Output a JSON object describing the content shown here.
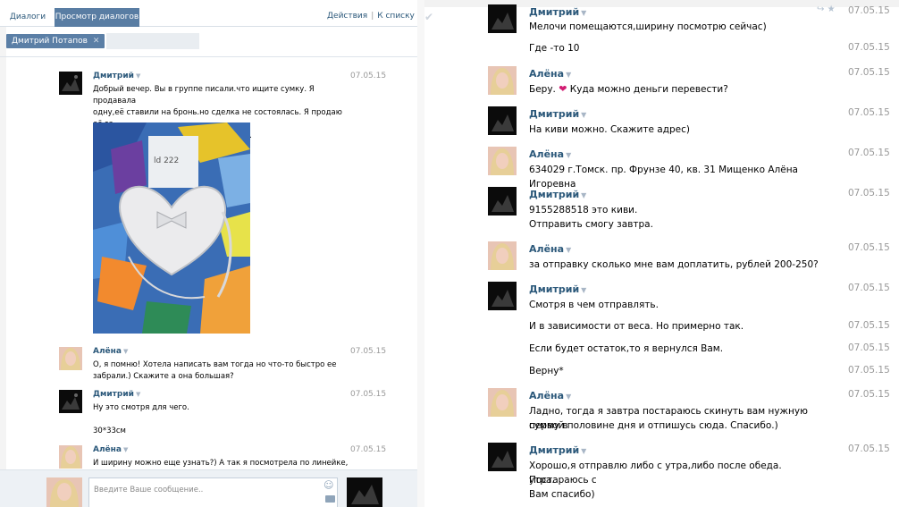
{
  "left": {
    "tabs": [
      "Диалоги",
      "Просмотр диалогов"
    ],
    "top_links": [
      "Действия",
      "К списку дру"
    ],
    "chip": {
      "label": "Дмитрий Потапов",
      "close": "✕"
    },
    "messages": [
      {
        "author": "Дмитрий",
        "date": "07.05.15",
        "lines": [
          "Добрый вечер. Вы в группе писали.что ищите сумку. Я продавала",
          "одну,её ставили на бронь.но сделка не состоялась. Я продаю её за",
          "600 руб,если заинтересует, то пишите."
        ]
      },
      {
        "author": "Алёна",
        "date": "07.05.15",
        "lines": [
          "О, я помню! Хотела написать вам тогда но что-то быстро ее",
          "забрали.) Скажите а она большая?"
        ]
      },
      {
        "author": "Дмитрий",
        "date": "07.05.15",
        "lines": [
          "Ну это смотря для чего.",
          "",
          "30*33см"
        ]
      },
      {
        "author": "Алёна",
        "date": "07.05.15",
        "lines": [
          "И ширину можно еще узнать?) А так я посмотрела по линейке,"
        ]
      }
    ],
    "photo_note": "ld 222",
    "composer": {
      "placeholder": "Введите Ваше сообщение.."
    }
  },
  "right": {
    "messages": [
      {
        "author": "Дмитрий",
        "lines": [
          {
            "text": "Мелочи помещаются,ширину посмотрю сейчас)",
            "date": "07.05.15"
          },
          {
            "text": "Где -то 10",
            "date": "07.05.15"
          }
        ]
      },
      {
        "author": "Алёна",
        "lines": [
          {
            "text": "Беру.",
            "extra": "Куда можно деньги перевести?",
            "date": "07.05.15"
          }
        ]
      },
      {
        "author": "Дмитрий",
        "lines": [
          {
            "text": "На киви можно. Скажите адрес)",
            "date": "07.05.15"
          }
        ]
      },
      {
        "author": "Алёна",
        "lines": [
          {
            "text": "634029 г.Томск. пр. Фрунзе 40, кв. 31 Мищенко Алёна Игоревна",
            "date": "07.05.15"
          }
        ]
      },
      {
        "author": "Дмитрий",
        "lines": [
          {
            "text": "9155288518 это киви.",
            "date": "07.05.15"
          },
          {
            "text": "Отправить смогу завтра.",
            "date": ""
          }
        ]
      },
      {
        "author": "Алёна",
        "lines": [
          {
            "text": "за отправку сколько мне вам доплатить, рублей 200-250?",
            "date": "07.05.15"
          }
        ]
      },
      {
        "author": "Дмитрий",
        "lines": [
          {
            "text": "Смотря в чем отправлять.",
            "date": "07.05.15"
          },
          {
            "text": "И в зависимости от веса. Но примерно так.",
            "date": "07.05.15"
          },
          {
            "text": "Если будет остаток,то я вернулся Вам.",
            "date": "07.05.15"
          },
          {
            "text": "Верну*",
            "date": "07.05.15"
          }
        ]
      },
      {
        "author": "Алёна",
        "lines": [
          {
            "text": "Ладно, тогда я завтра постараюсь скинуть вам нужную сумму в",
            "date": "07.05.15"
          },
          {
            "text": "первой половине дня и отпишусь сюда. Спасибо.)",
            "date": ""
          }
        ]
      },
      {
        "author": "Дмитрий",
        "lines": [
          {
            "text": "Хорошо,я отправлю либо с утра,либо после обеда. Постараюсь с",
            "date": "07.05.15"
          },
          {
            "text": "утра.",
            "date": ""
          },
          {
            "text": "Вам спасибо)",
            "date": ""
          }
        ]
      }
    ]
  },
  "colors": {
    "link": "#2b587a",
    "tab_active": "#597da3",
    "date": "#999999",
    "heart": "#d21c72"
  }
}
